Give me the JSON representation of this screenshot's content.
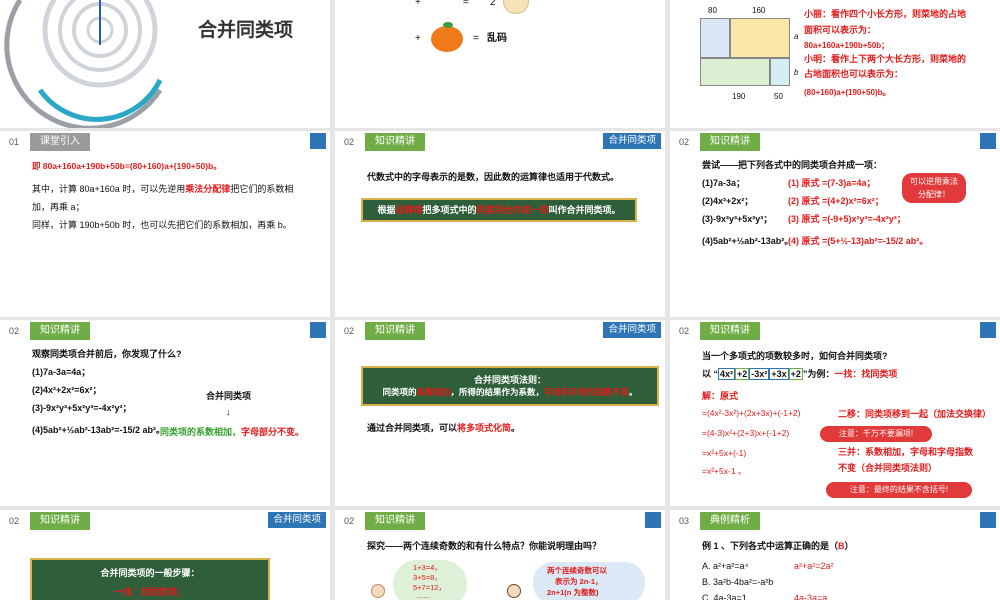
{
  "s1": {
    "title": "合并同类项"
  },
  "s2": {
    "eq_tail": "2",
    "result": "乱码"
  },
  "s3": {
    "dim_top_a": "80",
    "dim_top_b": "160",
    "dim_side_a": "a",
    "dim_side_b": "b",
    "dim_bot_a": "190",
    "dim_bot_b": "50",
    "line1": "小丽：看作四个小长方形，则菜地的占地",
    "line2": "面积可以表示为：",
    "line3": "80a+160a+190b+50b；",
    "line4": "小明：看作上下两个大长方形，则菜地的",
    "line5": "占地面积也可以表示为：",
    "line6": "(80+160)a+(190+50)b。"
  },
  "s4": {
    "num": "01",
    "label": "课堂引入",
    "l1": "即 80a+160a+190b+50b=(80+160)a+(190+50)b。",
    "l2a": "其中，计算 80a+160a 时，可以先逆用",
    "l2b": "乘法分配律",
    "l2c": "把它们的系数相",
    "l3": "加，再乘 a；",
    "l4": "同样，计算 190b+50b 时，也可以先把它们的系数相加，再乘 b。"
  },
  "s5": {
    "num": "02",
    "label": "知识精讲",
    "badge": "合并同类项",
    "l1": "代数式中的字母表示的是数，因此数的运算律也适用于代数式。",
    "b1": "根据",
    "b2": "运算律",
    "b3": "把多项式中的",
    "b4": "同类项合并成一项",
    "b5": "叫作合并同类项。"
  },
  "s6": {
    "num": "02",
    "label": "知识精讲",
    "title": "尝试——把下列各式中的同类项合并成一项：",
    "q": [
      "(1)7a-3a；",
      "(2)4x²+2x²；",
      "(3)-9x²y³+5x²y³；",
      "(4)5ab²+½ab²-13ab²。"
    ],
    "a": [
      "(1) 原式 =(7-3)a=4a；",
      "(2) 原式 =(4+2)x²=6x²；",
      "(3) 原式 =(-9+5)x²y³=-4x²y³；",
      "(4) 原式 =(5+½-13)ab²=-15/2 ab²。"
    ],
    "note": "可以逆用乘法分配律！"
  },
  "s7": {
    "num": "02",
    "label": "知识精讲",
    "title": "观察同类项合并前后，你发现了什么?",
    "items": [
      "(1)7a-3a=4a；",
      "(2)4x²+2x²=6x²；",
      "(3)-9x²y³+5x²y³=-4x²y³；",
      "(4)5ab²+½ab²-13ab²=-15/2 ab²。"
    ],
    "right_title": "合并同类项",
    "arrow": "↓",
    "conclusion_a": "同类项的系数相加，",
    "conclusion_b": "字母部分不变。"
  },
  "s8": {
    "num": "02",
    "label": "知识精讲",
    "badge": "合并同类项",
    "rule_title": "合并同类项法则：",
    "rule_a": "同类项的",
    "rule_b": "系数相加",
    "rule_c": "，所得的结果作为系数，",
    "rule_d": "字母和字母的指数不变",
    "rule_e": "。",
    "l2a": "通过合并同类项，可以",
    "l2b": "将多项式化简",
    "l2c": "。"
  },
  "s9": {
    "num": "02",
    "label": "知识精讲",
    "title": "当一个多项式的项数较多时，如何合并同类项?",
    "ex_pre": "以 “",
    "ex_terms": [
      "4x²",
      "+2",
      "-3x²",
      "+3x",
      "+2"
    ],
    "ex_post": "”为例：",
    "step1": "一找：找同类项",
    "sol": "解：原式",
    "lines": [
      "=(4x²-3x²)+(2x+3x)+(-1+2)",
      "=(4-3)x²+(2+3)x+(-1+2)",
      "=x²+5x+(-1)",
      "=x²+5x-1 。"
    ],
    "step2": "二移：同类项移到一起（加法交换律）",
    "note1": "注意：千万不要漏项!",
    "step3a": "三并：系数相加，字母和字母指数",
    "step3b": "不变（合并同类项法则）",
    "note2": "注意：最终的结果不含括号!"
  },
  "s10": {
    "num": "02",
    "label": "知识精讲",
    "badge": "合并同类项",
    "box_title": "合并同类项的一般步骤：",
    "box_line": "一找：找同类项；"
  },
  "s11": {
    "num": "02",
    "label": "知识精讲",
    "title": "探究——两个连续奇数的和有什么特点？你能说明理由吗？",
    "cloud": [
      "1+3=4，",
      "3+5=8，",
      "5+7=12，",
      "......"
    ],
    "bubble": [
      "两个连续奇数可以",
      "表示为 2n-1，",
      "2n+1(n 为整数)"
    ]
  },
  "s12": {
    "num": "03",
    "label": "典例精析",
    "q_a": "例 1 、下列各式中运算正确的是（",
    "q_ans": "B",
    "q_b": "）",
    "a": "A. a²+a²=a⁴",
    "a_fix": "a²+a²=2a²",
    "b": "B. 3a²b-4ba²=-a²b",
    "c": "C. 4a-3a=1",
    "c_fix": "4a-3a=a"
  }
}
